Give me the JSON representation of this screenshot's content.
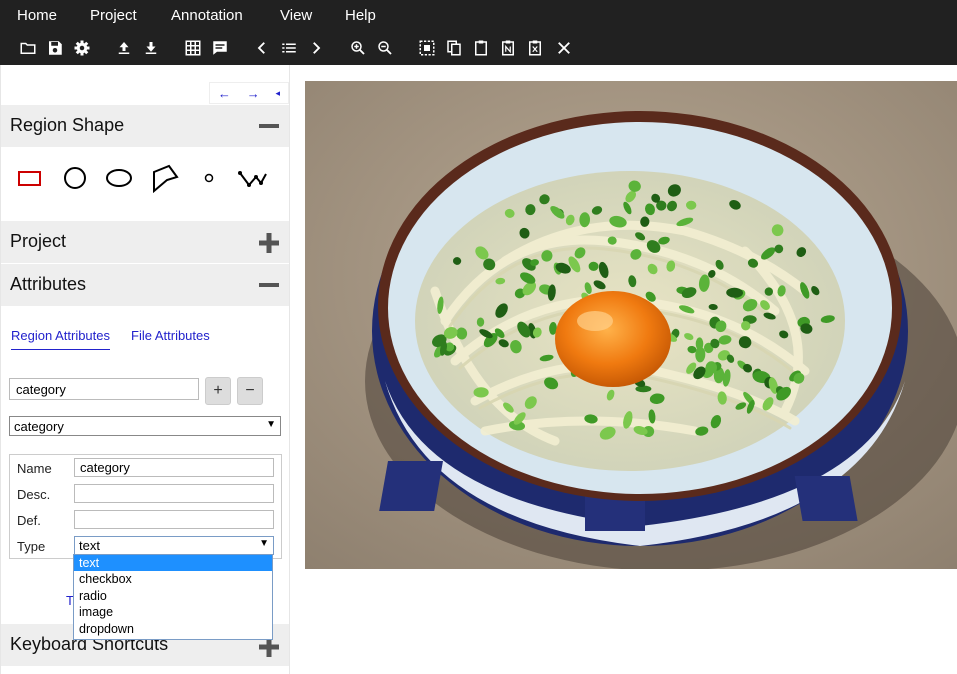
{
  "menu": [
    "Home",
    "Project",
    "Annotation",
    "View",
    "Help"
  ],
  "toolbar_icons": [
    "folder-open-icon",
    "save-icon",
    "settings-icon",
    "upload-icon",
    "download-icon",
    "grid-view-icon",
    "comment-icon",
    "prev-icon",
    "list-icon",
    "next-icon",
    "zoom-in-icon",
    "zoom-out-icon",
    "select-all-icon",
    "copy-icon",
    "paste-icon",
    "paste-n-icon",
    "paste-x-icon",
    "delete-icon"
  ],
  "panel_nav": {
    "left": "←",
    "right": "→",
    "collapse": "◂"
  },
  "sections": {
    "region_shape": "Region Shape",
    "project": "Project",
    "attributes": "Attributes",
    "keyboard_shortcuts": "Keyboard Shortcuts"
  },
  "shapes": [
    "rectangle",
    "circle",
    "ellipse",
    "polygon",
    "point",
    "polyline"
  ],
  "tabs": {
    "region": "Region Attributes",
    "file": "File Attributes"
  },
  "new_attr": {
    "value": "category",
    "add": "+",
    "remove": "−"
  },
  "attr_select": {
    "value": "category"
  },
  "attr_fields": {
    "name_label": "Name",
    "name_value": "category",
    "desc_label": "Desc.",
    "desc_value": "",
    "def_label": "Def.",
    "def_value": "",
    "type_label": "Type",
    "type_value": "text"
  },
  "type_options": [
    "text",
    "checkbox",
    "radio",
    "image",
    "dropdown"
  ],
  "hidden_link_char": "T",
  "colors": {
    "menubar": "#212121",
    "accent": "#2222cc",
    "selected": "#1e90ff",
    "rect_shape": "#cc0000"
  }
}
